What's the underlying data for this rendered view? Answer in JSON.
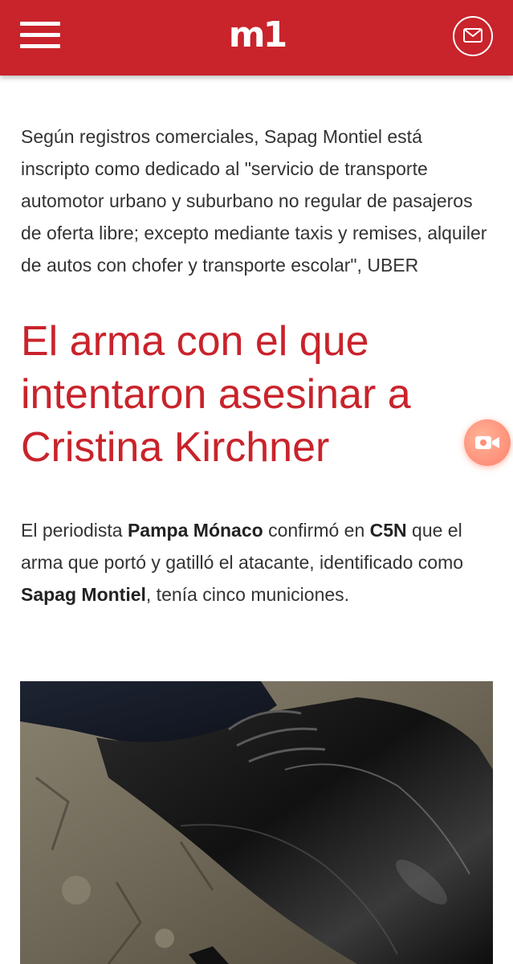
{
  "header": {
    "menu_icon": "hamburger-menu-icon",
    "logo_text": "m1",
    "mail_icon": "envelope-icon",
    "brand_color": "#c9232b"
  },
  "article": {
    "paragraph1": "Según registros comerciales, Sapag Montiel está inscripto como dedicado al \"servicio de transporte automotor urbano y suburbano no regular de pasajeros de oferta libre; excepto mediante taxis y remises, alquiler de autos con chofer y transporte escolar\", UBER",
    "heading": "El arma con el que intentaron asesinar a Cristina Kirchner",
    "paragraph2": {
      "part1": "El periodista ",
      "bold1": "Pampa Mónaco",
      "part2": " confirmó en ",
      "bold2": "C5N",
      "part3": " que el arma que portó y gatilló el atacante, identificado como ",
      "bold3": "Sapag Montiel",
      "part4": ", tenía cinco municiones."
    },
    "image_icon": "photo-black-shoe"
  },
  "floating": {
    "video_icon": "video-camera-icon",
    "accent_color": "#ff8f78"
  }
}
